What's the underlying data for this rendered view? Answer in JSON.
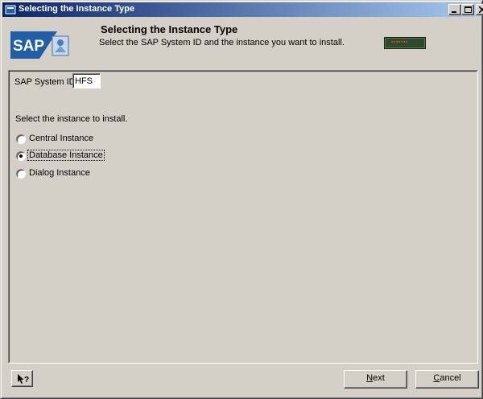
{
  "window": {
    "title": "Selecting the Instance Type",
    "controls": {
      "minimize": "minimize",
      "maximize": "maximize",
      "close": "close"
    }
  },
  "header": {
    "logo_text": "SAP",
    "title": "Selecting the Instance Type",
    "description": "Select the SAP System ID and the instance you want to install."
  },
  "form": {
    "sid_label": "SAP System ID",
    "sid_value": "HFS",
    "select_prompt": "Select the instance to install.",
    "instances": [
      {
        "label": "Central Instance",
        "selected": false
      },
      {
        "label": "Database Instance",
        "selected": true
      },
      {
        "label": "Dialog Instance",
        "selected": false
      }
    ]
  },
  "footer": {
    "help_icon": "context-help-icon",
    "next_mnemonic": "N",
    "next_rest": "ext",
    "cancel_mnemonic": "C",
    "cancel_rest": "ancel"
  },
  "colors": {
    "titlebar_start": "#0a246a",
    "titlebar_end": "#a6caf0",
    "face": "#d4d0c8",
    "sap_blue": "#1f5fa8",
    "led_bg": "#2c4a2c",
    "led_text": "#ff3b2a"
  }
}
